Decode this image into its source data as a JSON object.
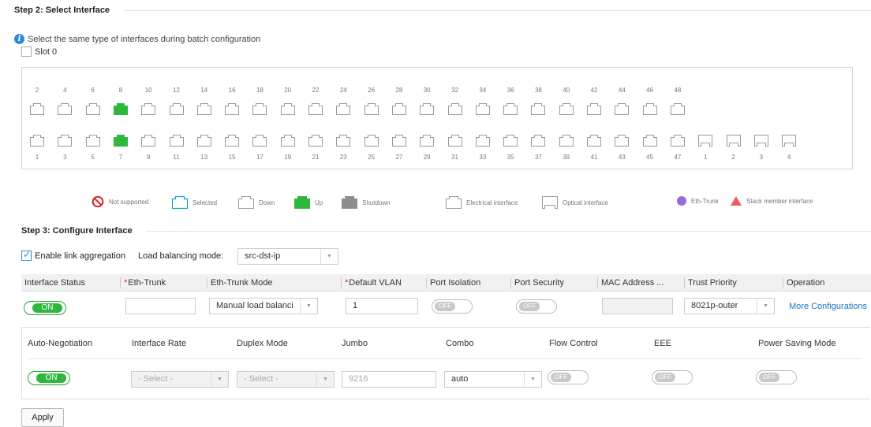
{
  "step2": {
    "title": "Step 2: Select Interface",
    "info": "Select the same type of interfaces during batch configuration",
    "slot_label": "Slot 0"
  },
  "ports": {
    "top_numbers": [
      "2",
      "4",
      "6",
      "8",
      "10",
      "12",
      "14",
      "16",
      "18",
      "20",
      "22",
      "24",
      "26",
      "28",
      "30",
      "32",
      "34",
      "36",
      "38",
      "40",
      "42",
      "44",
      "46",
      "48"
    ],
    "bottom_numbers": [
      "1",
      "3",
      "5",
      "7",
      "9",
      "11",
      "13",
      "15",
      "17",
      "19",
      "21",
      "23",
      "25",
      "27",
      "29",
      "31",
      "33",
      "35",
      "37",
      "39",
      "41",
      "43",
      "45",
      "47"
    ],
    "optical_numbers": [
      "1",
      "2",
      "3",
      "4"
    ],
    "up_ports": [
      "8",
      "7"
    ]
  },
  "legend": {
    "not_supported": "Not supported",
    "selected": "Selected",
    "down": "Down",
    "up": "Up",
    "shutdown": "Shutdown",
    "electrical": "Electrical interface",
    "optical": "Optical interface",
    "eth_trunk": "Eth-Trunk",
    "stack_member": "Stack member interface"
  },
  "step3": {
    "title": "Step 3: Configure Interface",
    "enable_link_aggregation": "Enable link aggregation",
    "load_balancing_label": "Load balancing mode:",
    "load_balancing_value": "src-dst-ip"
  },
  "table": {
    "headers": {
      "interface_status": "Interface Status",
      "eth_trunk": "Eth-Trunk",
      "eth_trunk_mode": "Eth-Trunk Mode",
      "default_vlan": "Default VLAN",
      "port_isolation": "Port Isolation",
      "port_security": "Port Security",
      "mac_address": "MAC Address ...",
      "trust_priority": "Trust Priority",
      "operation": "Operation"
    },
    "row": {
      "interface_status": "ON",
      "eth_trunk": "",
      "eth_trunk_mode": "Manual load balanci",
      "default_vlan": "1",
      "port_isolation": "OFF",
      "port_security": "OFF",
      "mac_address": "",
      "trust_priority": "8021p-outer",
      "operation": "More Configurations"
    }
  },
  "advanced": {
    "headers": {
      "auto_negotiation": "Auto-Negotiation",
      "interface_rate": "Interface Rate",
      "duplex_mode": "Duplex Mode",
      "jumbo": "Jumbo",
      "combo": "Combo",
      "flow_control": "Flow Control",
      "eee": "EEE",
      "power_saving": "Power Saving Mode"
    },
    "row": {
      "auto_negotiation": "ON",
      "interface_rate": "- Select -",
      "duplex_mode": "- Select -",
      "jumbo_placeholder": "9216",
      "combo": "auto",
      "flow_control": "OFF",
      "eee": "OFF",
      "power_saving": "OFF"
    }
  },
  "apply_label": "Apply",
  "colors": {
    "up": "#2db83d",
    "port_outline": "#9a9a9a",
    "selected": "#1aa0c8",
    "link": "#1a73c7",
    "required": "#e0262d",
    "eth_trunk": "#9b6bdb",
    "stack": "#f05a5a"
  }
}
